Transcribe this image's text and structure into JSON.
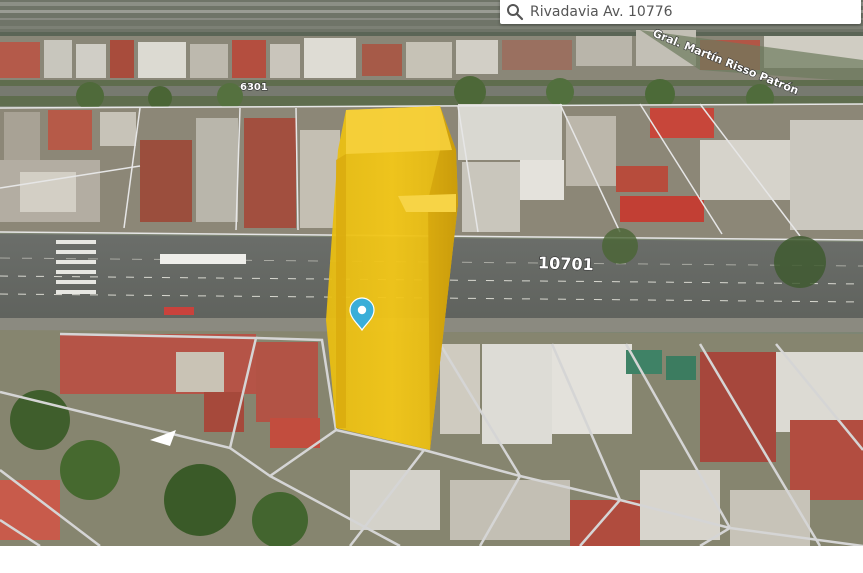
{
  "search": {
    "query": "Rivadavia Av. 10776",
    "icon": "search-icon"
  },
  "map": {
    "labels": {
      "street_number_main": "10701",
      "street_number_top": "6301",
      "street_name_diagonal": "Gral. Martín Risso Patrón"
    },
    "building_color": "#f0c419",
    "marker_color": "#3aaed8",
    "marker_icon": "map-pin-icon"
  }
}
